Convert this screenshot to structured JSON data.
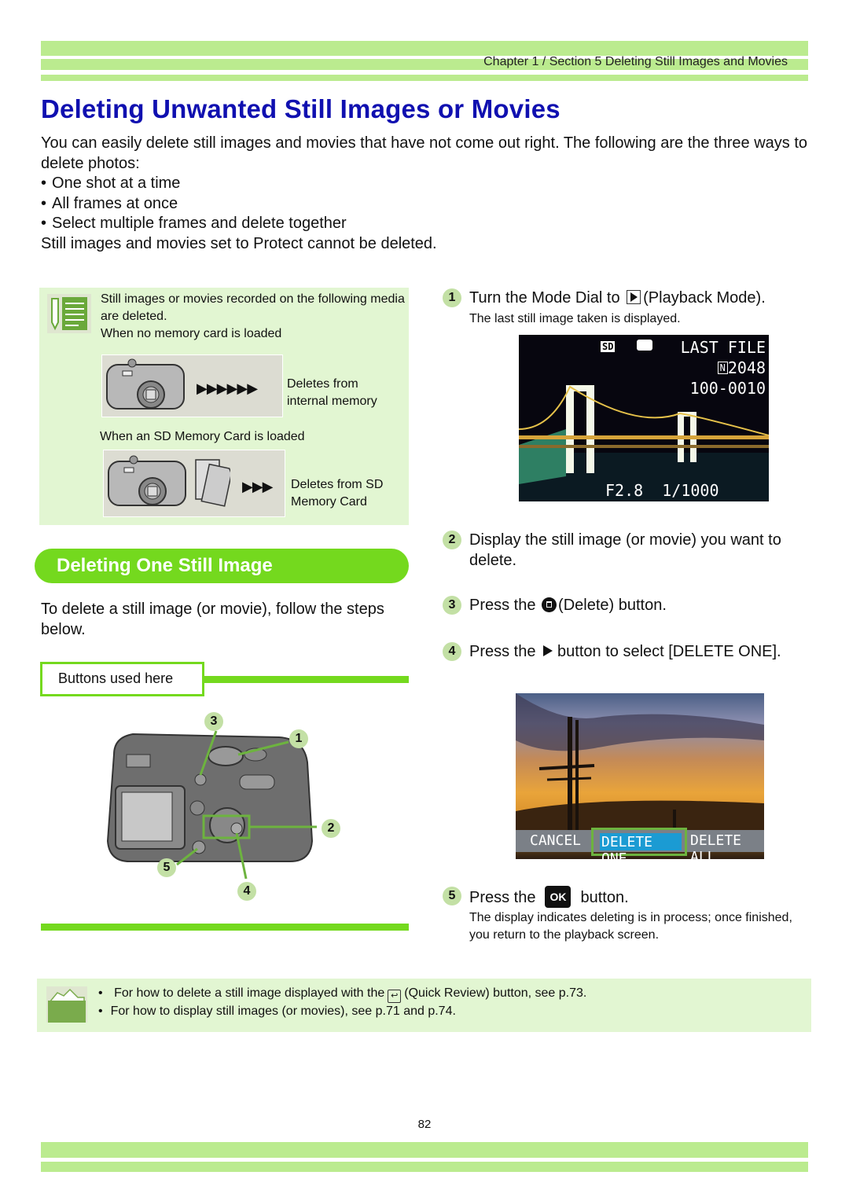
{
  "header": {
    "chapter": "Chapter  1 / Section 5  Deleting Still Images and Movies"
  },
  "title": "Deleting Unwanted Still Images or Movies",
  "intro": {
    "lead": "You can easily delete still images and movies that have not come out right. The following are the three ways to delete photos:",
    "bullets": [
      "One shot at a time",
      "All frames at once",
      "Select multiple frames and delete together"
    ],
    "closing": "Still images and movies set to Protect cannot be deleted."
  },
  "note": {
    "icon": "memo-pencil-icon",
    "line1": "Still images or movies recorded on the following media are deleted.",
    "no_card_heading": "When no memory card is loaded",
    "no_card_result": [
      "Deletes from",
      "internal memory"
    ],
    "sd_heading": "When an SD Memory Card is loaded",
    "sd_result": [
      "Deletes from SD",
      "Memory Card"
    ],
    "arrows_long": "▶▶▶▶▶▶",
    "arrows_short": "▶▶▶"
  },
  "section": {
    "heading": "Deleting One Still Image",
    "intro": "To delete a still image (or movie), follow the steps below.",
    "buttons_used_label": "Buttons used here",
    "callouts": [
      "1",
      "2",
      "3",
      "4",
      "5"
    ]
  },
  "steps": [
    {
      "num": "1",
      "text_before": "Turn the Mode Dial to",
      "icon": "playback-mode-icon",
      "text_after": "(Playback Mode).",
      "sub": "The last still image taken is displayed."
    },
    {
      "num": "2",
      "text": "Display the still image (or movie) you want to delete."
    },
    {
      "num": "3",
      "text_before": "Press the",
      "icon": "delete-trash-icon",
      "text_after": "(Delete) button."
    },
    {
      "num": "4",
      "text_before": "Press the",
      "icon": "right-arrow-icon",
      "text_after": "button to select [DELETE ONE]."
    },
    {
      "num": "5",
      "text_before": "Press the",
      "icon_label": "OK",
      "text_after": "button.",
      "sub": "The display indicates deleting is in process; once finished, you return to the playback screen."
    }
  ],
  "screen1": {
    "media": "SD",
    "label": "LAST FILE",
    "size_badge": "N",
    "size": "2048",
    "file_no": "100-0010",
    "exposure": "F2.8  1/1000"
  },
  "screen2": {
    "menu": [
      "CANCEL",
      "DELETE ONE",
      "DELETE ALL"
    ],
    "selected": "DELETE ONE"
  },
  "tip": {
    "icon": "hint-hand-icon",
    "items": [
      {
        "before": "For how to delete a still image displayed with the",
        "icon": "quick-review-icon",
        "after": "(Quick Review) button, see p.73."
      },
      {
        "text": "For how to display still images (or movies), see p.71 and p.74."
      }
    ]
  },
  "page_number": "82",
  "colors": {
    "title": "#1010b0",
    "accent_green": "#74d91e",
    "bar_green": "#bbeb8f",
    "panel_green": "#e2f6d2",
    "step_circle": "#c3e0a5"
  }
}
